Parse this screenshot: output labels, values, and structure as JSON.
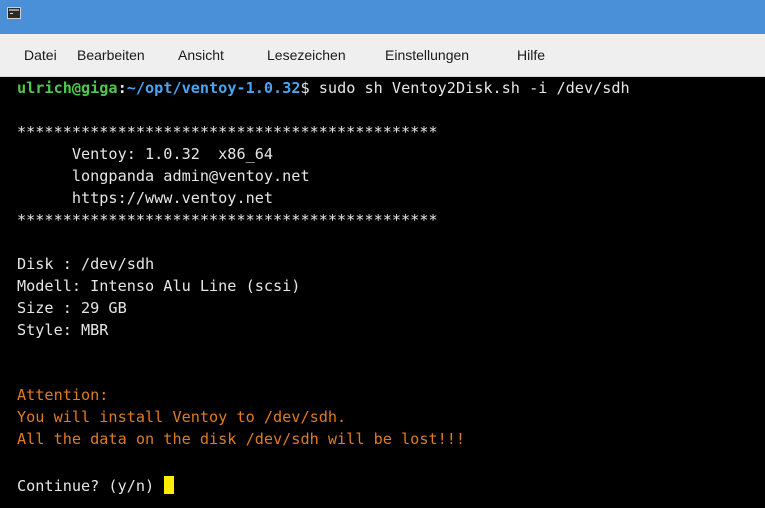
{
  "window": {
    "app_icon": "terminal-icon"
  },
  "menu": {
    "items": [
      "Datei",
      "Bearbeiten",
      "Ansicht",
      "Lesezeichen",
      "Einstellungen",
      "Hilfe"
    ]
  },
  "terminal": {
    "prompt": {
      "user_host": "ulrich@giga",
      "separator": ":",
      "path": "~/opt/ventoy-1.0.32",
      "symbol": "$",
      "command": " sudo sh Ventoy2Disk.sh -i /dev/sdh"
    },
    "banner": {
      "border_top": "**********************************************",
      "version": "      Ventoy: 1.0.32  x86_64",
      "author": "      longpanda admin@ventoy.net",
      "url": "      https://www.ventoy.net",
      "border_bottom": "**********************************************"
    },
    "disk_info": {
      "disk": "Disk : /dev/sdh",
      "model": "Modell: Intenso Alu Line (scsi)",
      "size": "Size : 29 GB",
      "style": "Style: MBR"
    },
    "warning": {
      "title": "Attention:",
      "line1": "You will install Ventoy to /dev/sdh.",
      "line2": "All the data on the disk /dev/sdh will be lost!!!"
    },
    "input_prompt": "Continue? (y/n) "
  },
  "colors": {
    "titlebar": "#4a90d9",
    "menubar": "#efefef",
    "terminal_bg": "#000000",
    "terminal_fg": "#e6e6e6",
    "prompt_user": "#4ec94e",
    "prompt_path": "#4aa4ef",
    "warning": "#e07b1f",
    "cursor": "#ffee00"
  }
}
